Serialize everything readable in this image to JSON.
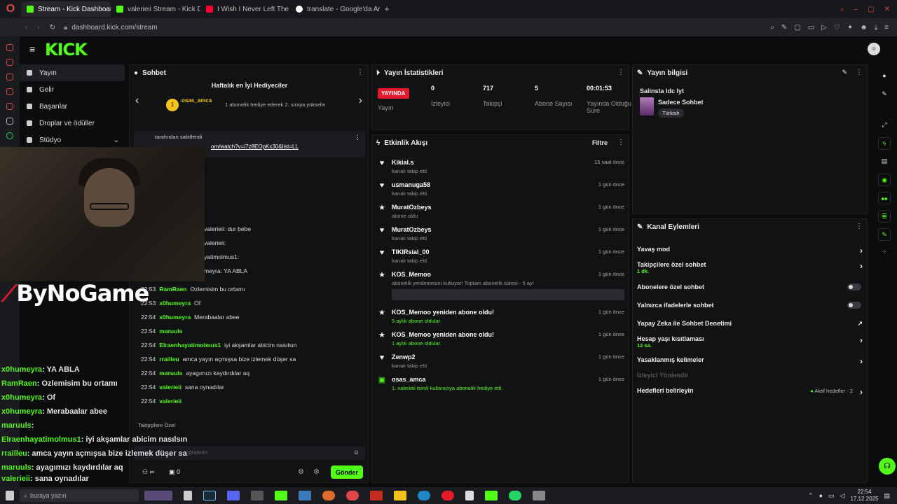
{
  "browser": {
    "tabs": [
      {
        "label": "Stream - Kick Dashboard",
        "color": "#53fc18"
      },
      {
        "label": "valerieii Stream - Kick D",
        "color": "#53fc18"
      },
      {
        "label": "I Wish I Never Left The F",
        "color": "#ff0033"
      },
      {
        "label": "translate - Google'da Ara",
        "color": "#ffffff"
      }
    ],
    "url": "dashboard.kick.com/stream"
  },
  "header": {
    "logo": "KICK"
  },
  "nav": {
    "items": [
      {
        "label": "Yayın"
      },
      {
        "label": "Gelir"
      },
      {
        "label": "Başarılar"
      },
      {
        "label": "Droplar ve ödüller"
      },
      {
        "label": "Stüdyo"
      }
    ]
  },
  "overlay": {
    "brand": "ByNoGame",
    "lines": [
      {
        "user": "x0humeyra",
        "msg": ": YA ABLA"
      },
      {
        "user": "RamRaen",
        "msg": ": Ozlemisim bu ortamı"
      },
      {
        "user": "x0humeyra",
        "msg": ": Of"
      },
      {
        "user": "x0humeyra",
        "msg": ": Merabaalar abee"
      },
      {
        "user": "maruuls",
        "msg": ":"
      },
      {
        "user": "Elraenhayatimolmus1",
        "msg": ": iyi akşamlar abicim nasılsın"
      },
      {
        "user": "rrailleu",
        "msg": ": amca yayın açmışsa bize izlemek düşer sa"
      },
      {
        "user": "maruuls",
        "msg": ": ayagımızı kaydırdılar aq"
      },
      {
        "user": "valerieii",
        "msg": ": sana oynadılar"
      }
    ],
    "input_placeholder": "buraya yazın"
  },
  "chat": {
    "title": "Sohbet",
    "top_gifters": "Haftalık en İyi Hediyeciler",
    "gifter_name": "osas_amca",
    "gifter_note": "1 abonelik hediye ederek 2. sıraya yükselin",
    "pinned_by": "tarafından sabitlendi",
    "pinned_link": "om/watch?v=i7z8EOpKx30&list=LL",
    "rows": [
      {
        "time": "22:53",
        "user": "RamRaen",
        "msg": "Ozlemisim bu ortamı"
      },
      {
        "time": "22:53",
        "user": "x0humeyra",
        "msg": "Of"
      },
      {
        "time": "22:54",
        "user": "x0humeyra",
        "msg": "Merabaalar abee"
      },
      {
        "time": "22:54",
        "user": "maruuls",
        "msg": ""
      },
      {
        "time": "22:54",
        "user": "Elraenhayatimolmus1",
        "msg": "iyi akşamlar abicim nasılsın"
      },
      {
        "time": "22:54",
        "user": "rrailleu",
        "msg": "amca yayın açmışsa bize izlemek düşer sa"
      },
      {
        "time": "22:54",
        "user": "maruuls",
        "msg": "ayagımızı kaydırdılar aq"
      },
      {
        "time": "22:54",
        "user": "valerieii",
        "msg": "sana oynadılar"
      },
      {
        "time": "22:54",
        "user": "valerieii",
        "msg": ""
      }
    ],
    "upper_rows": [
      {
        "text": "valerieii: dur bebe"
      },
      {
        "text": "valerieii:"
      },
      {
        "text": "yatimolmus1:"
      },
      {
        "text": "meyra: YA ABLA"
      }
    ],
    "followers_only": "Takipçilere Özel",
    "input_placeholder": "gönderin",
    "count": "0",
    "send": "Gönder"
  },
  "stats": {
    "title": "Yayın İstatistikleri",
    "live": "YAYINDA",
    "live_label": "Yayın",
    "items": [
      {
        "value": "0",
        "label": "İzleyici"
      },
      {
        "value": "717",
        "label": "Takipçi"
      },
      {
        "value": "5",
        "label": "Abone Sayısı"
      },
      {
        "value": "00:01:53",
        "label": "Yayında Olduğu Süre"
      }
    ]
  },
  "activity": {
    "title": "Etkinlik Akışı",
    "filter": "Filtre",
    "items": [
      {
        "icon": "♥",
        "name": "Kikial.s",
        "desc": "kanalı takip etti",
        "time": "15 saat önce"
      },
      {
        "icon": "♥",
        "name": "usmanuga58",
        "desc": "kanalı takip etti",
        "time": "1 gün önce"
      },
      {
        "icon": "★",
        "name": "MuratOzbeys",
        "desc": "abone oldu",
        "time": "1 gün önce"
      },
      {
        "icon": "♥",
        "name": "MuratOzbeys",
        "desc": "kanalı takip etti",
        "time": "1 gün önce"
      },
      {
        "icon": "♥",
        "name": "TIKIRsial_00",
        "desc": "kanalı takip etti",
        "time": "1 gün önce"
      },
      {
        "icon": "★",
        "name": "KOS_Memoo",
        "desc": "abonelik yenilemesini kutluyor! Toplam abonelik süresi - 5 ay!",
        "time": "1 gün önce"
      },
      {
        "icon": "★",
        "name": "KOS_Memoo yeniden abone oldu!",
        "desc": "5 aylık abone oldular",
        "time": "1 gün önce"
      },
      {
        "icon": "★",
        "name": "KOS_Memoo yeniden abone oldu!",
        "desc": "1 aylık abone oldular",
        "time": "1 gün önce"
      },
      {
        "icon": "♥",
        "name": "Zenwp2",
        "desc": "kanalı takip etti",
        "time": "1 gün önce"
      },
      {
        "icon": "▣",
        "name": "osas_amca",
        "desc": "1. valerieii isimli kullanıcıya abonelik hediye etti.",
        "time": "1 gün önce"
      }
    ]
  },
  "info": {
    "title": "Yayın bilgisi",
    "stream_title": "Salinsta Idc Iyt",
    "category": "Sadece Sohbet",
    "tag": "Türkish"
  },
  "actions": {
    "title": "Kanal Eylemleri",
    "items": [
      {
        "label": "Yavaş mod",
        "sub": "",
        "kind": "chevron"
      },
      {
        "label": "Takipçilere özel sohbet",
        "sub": "1 dk.",
        "kind": "chevron"
      },
      {
        "label": "Abonelere özel sohbet",
        "sub": "",
        "kind": "toggle"
      },
      {
        "label": "Yalnızca ifadelerle sohbet",
        "sub": "",
        "kind": "toggle"
      },
      {
        "label": "Yapay Zeka ile Sohbet Denetimi",
        "sub": "",
        "kind": "link"
      },
      {
        "label": "Hesap yaşı kısıtlaması",
        "sub": "12 sa.",
        "kind": "chevron"
      },
      {
        "label": "Yasaklanmış kelimeler",
        "sub": "",
        "kind": "chevron"
      },
      {
        "label": "İzleyici Yönlendir",
        "sub": "",
        "kind": "disabled"
      },
      {
        "label": "Hedefleri belirleyin",
        "sub": "",
        "kind": "chevron"
      }
    ],
    "goals_badge": "Aktif hedefler - 2"
  },
  "taskbar": {
    "time": "22:54",
    "date": "17.12.2025"
  }
}
